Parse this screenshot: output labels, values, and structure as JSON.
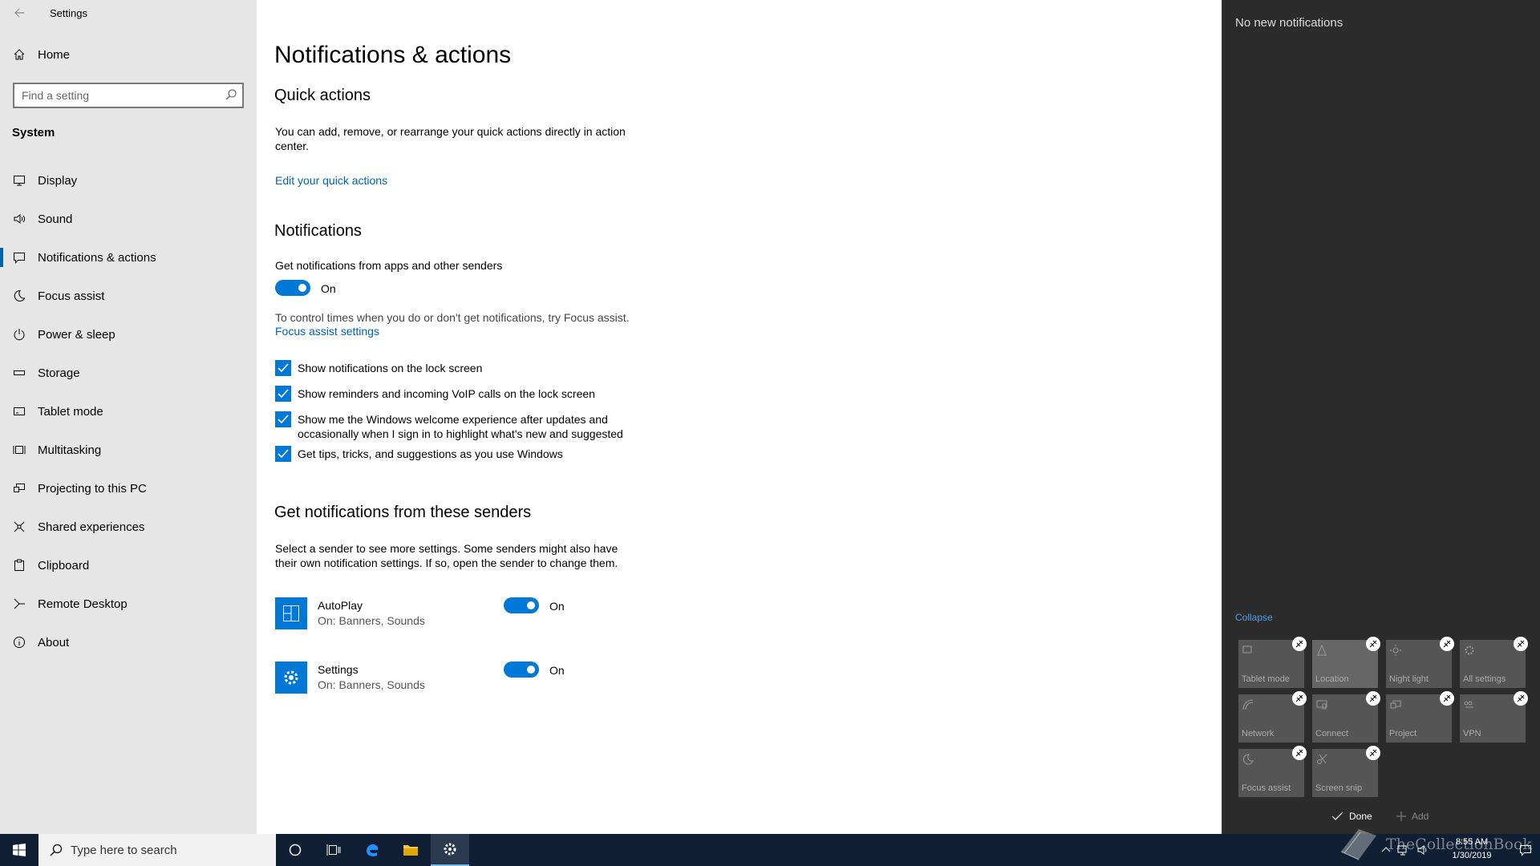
{
  "window": {
    "title": "Settings"
  },
  "sidebar": {
    "home": "Home",
    "search_placeholder": "Find a setting",
    "section": "System",
    "items": [
      {
        "label": "Display",
        "icon": "display-icon"
      },
      {
        "label": "Sound",
        "icon": "sound-icon"
      },
      {
        "label": "Notifications & actions",
        "icon": "notifications-icon",
        "active": true
      },
      {
        "label": "Focus assist",
        "icon": "moon-icon"
      },
      {
        "label": "Power & sleep",
        "icon": "power-icon"
      },
      {
        "label": "Storage",
        "icon": "storage-icon"
      },
      {
        "label": "Tablet mode",
        "icon": "tablet-icon"
      },
      {
        "label": "Multitasking",
        "icon": "multitasking-icon"
      },
      {
        "label": "Projecting to this PC",
        "icon": "projecting-icon"
      },
      {
        "label": "Shared experiences",
        "icon": "shared-icon"
      },
      {
        "label": "Clipboard",
        "icon": "clipboard-icon"
      },
      {
        "label": "Remote Desktop",
        "icon": "remote-desktop-icon"
      },
      {
        "label": "About",
        "icon": "info-icon"
      }
    ]
  },
  "main": {
    "title": "Notifications & actions",
    "quick_actions": {
      "heading": "Quick actions",
      "desc": "You can add, remove, or rearrange your quick actions directly in action center.",
      "link": "Edit your quick actions"
    },
    "notifications": {
      "heading": "Notifications",
      "toggle_label": "Get notifications from apps and other senders",
      "toggle_state": "On",
      "focus_text": "To control times when you do or don't get notifications, try Focus assist.",
      "focus_link": "Focus assist settings",
      "checkboxes": [
        "Show notifications on the lock screen",
        "Show reminders and incoming VoIP calls on the lock screen",
        "Show me the Windows welcome experience after updates and occasionally when I sign in to highlight what's new and suggested",
        "Get tips, tricks, and suggestions as you use Windows"
      ]
    },
    "senders": {
      "heading": "Get notifications from these senders",
      "desc": "Select a sender to see more settings. Some senders might also have their own notification settings. If so, open the sender to change them.",
      "items": [
        {
          "name": "AutoPlay",
          "sub": "On: Banners, Sounds",
          "state": "On"
        },
        {
          "name": "Settings",
          "sub": "On: Banners, Sounds",
          "state": "On"
        }
      ]
    }
  },
  "action_center": {
    "no_notifications": "No new notifications",
    "collapse": "Collapse",
    "tiles": [
      "Tablet mode",
      "Location",
      "Night light",
      "All settings",
      "Network",
      "Connect",
      "Project",
      "VPN",
      "Focus assist",
      "Screen snip"
    ],
    "done": "Done",
    "add": "Add"
  },
  "taskbar": {
    "search_placeholder": "Type here to search",
    "time": "8:55 AM",
    "date": "1/30/2019",
    "watermark": "TheCollectionBook"
  },
  "colors": {
    "accent": "#0078d7",
    "link": "#0063b1",
    "taskbar": "#101f33",
    "action_center": "#2b2b2b"
  }
}
